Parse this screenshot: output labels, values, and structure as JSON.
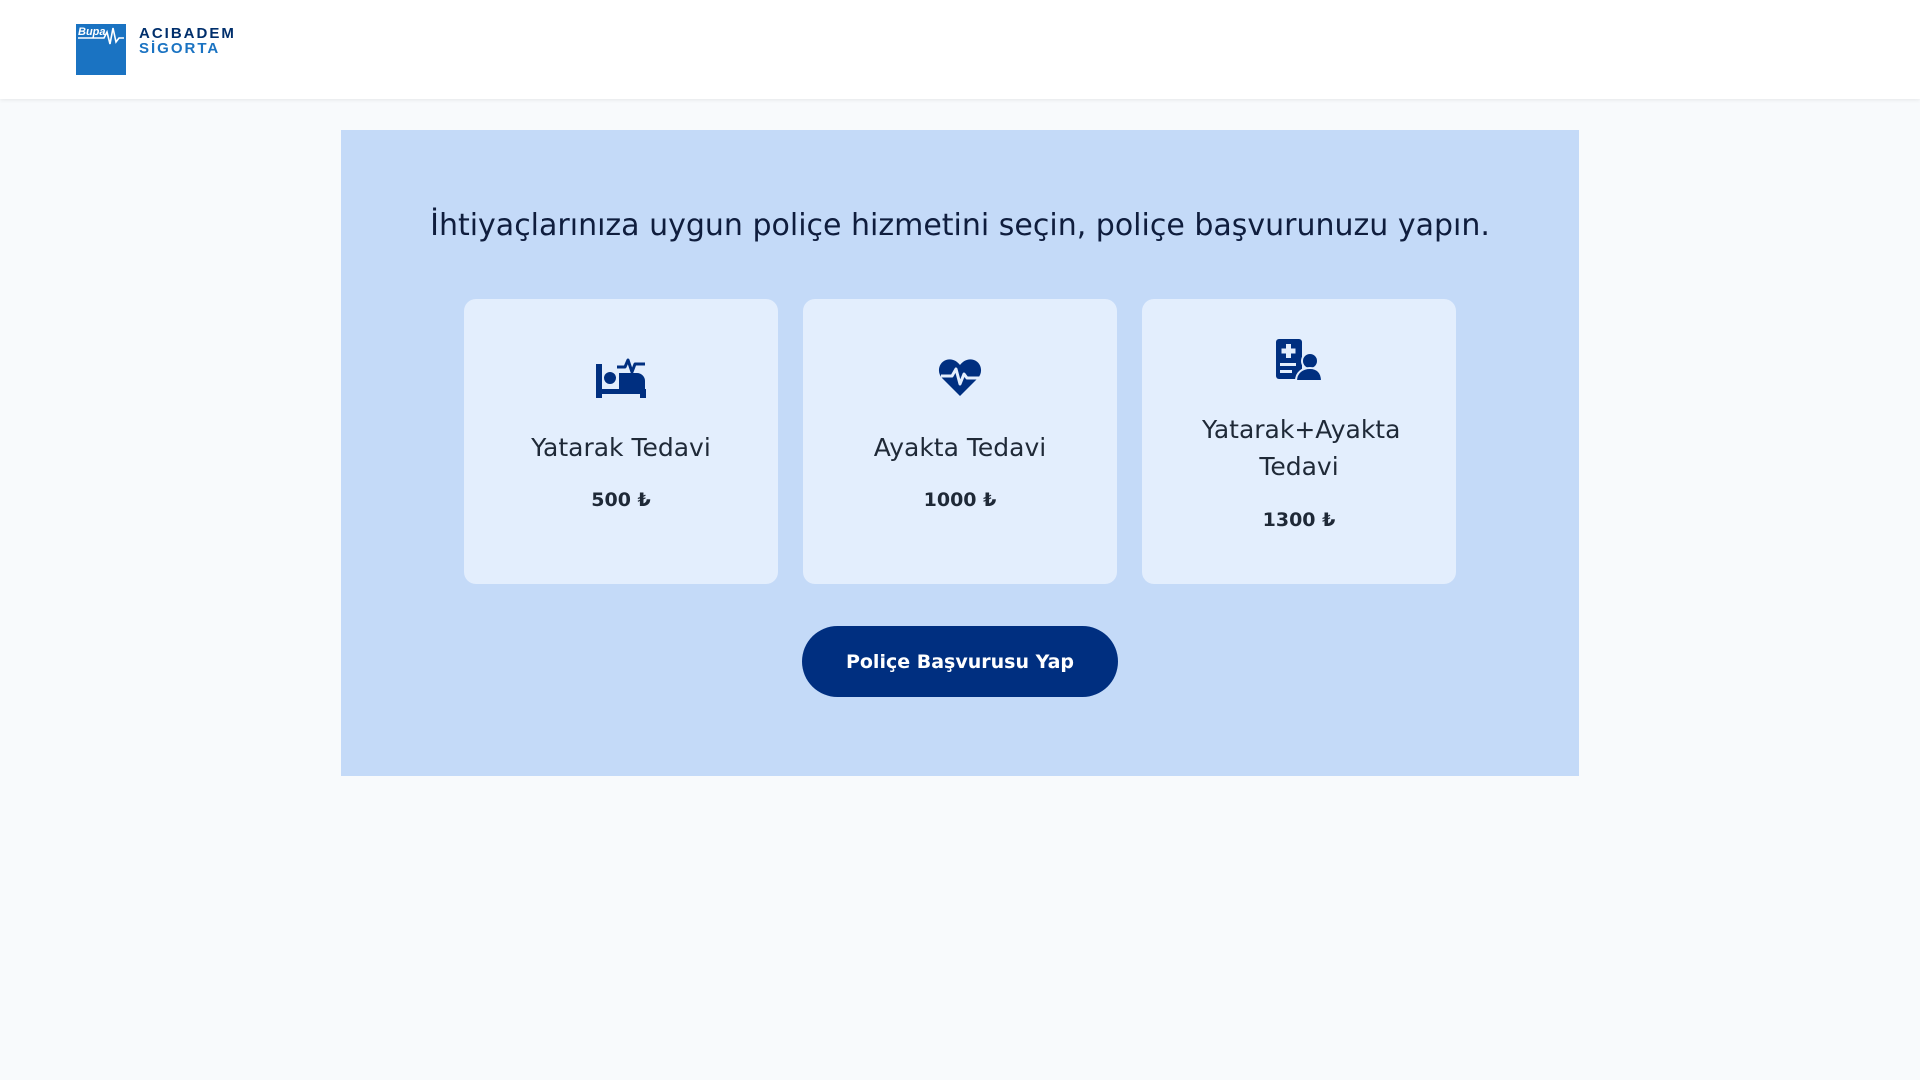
{
  "header": {
    "logo": {
      "mark_text": "Bupa",
      "line1": "ACIBADEM",
      "line2": "SİGORTA"
    }
  },
  "main": {
    "title": "İhtiyaçlarınıza uygun poliçe hizmetini seçin, poliçe başvurunuzu yapın.",
    "cards": [
      {
        "icon": "hospital-bed-icon",
        "name": "Yatarak Tedavi",
        "price": "500 ₺"
      },
      {
        "icon": "heart-pulse-icon",
        "name": "Ayakta Tedavi",
        "price": "1000 ₺"
      },
      {
        "icon": "medical-record-user-icon",
        "name": "Yatarak+Ayakta Tedavi",
        "price": "1300 ₺"
      }
    ],
    "apply_button": "Poliçe Başvurusu Yap"
  },
  "colors": {
    "brand_navy": "#002f80",
    "brand_blue": "#1a73c2",
    "panel_bg": "#c4daf8",
    "card_bg": "#e3eefd"
  }
}
